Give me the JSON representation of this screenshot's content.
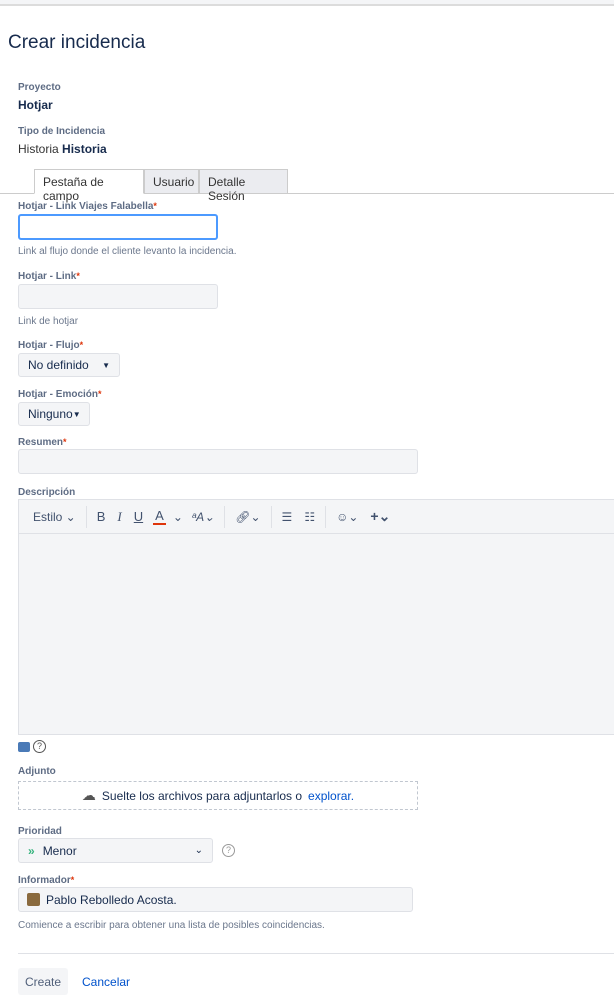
{
  "title": "Crear incidencia",
  "project": {
    "label": "Proyecto",
    "value": "Hotjar"
  },
  "issue_type": {
    "label": "Tipo de Incidencia",
    "icon_alt": "Historia",
    "value": "Historia"
  },
  "tabs": [
    {
      "label": "Pestaña de campo",
      "active": true
    },
    {
      "label": "Usuario"
    },
    {
      "label": "Detalle Sesión"
    }
  ],
  "fields": {
    "link_viajes": {
      "label": "Hotjar - Link Viajes Falabella",
      "required": "*",
      "value": "",
      "hint": "Link al flujo donde el cliente levanto la incidencia."
    },
    "link": {
      "label": "Hotjar - Link",
      "required": "*",
      "value": "",
      "hint": "Link de hotjar"
    },
    "flujo": {
      "label": "Hotjar - Flujo",
      "required": "*",
      "value": "No definido"
    },
    "emocion": {
      "label": "Hotjar - Emoción",
      "required": "*",
      "value": "Ninguno"
    },
    "resumen": {
      "label": "Resumen",
      "required": "*",
      "value": ""
    },
    "descripcion": {
      "label": "Descripción",
      "toolbar": {
        "style": "Estilo",
        "bold": "B",
        "italic": "I",
        "underline": "U",
        "color": "A",
        "size": "ᵃA"
      }
    },
    "adjunto": {
      "label": "Adjunto",
      "drop_text": "Suelte los archivos para adjuntarlos o",
      "browse": "explorar."
    },
    "prioridad": {
      "label": "Prioridad",
      "value": "Menor",
      "color": "#36b37e"
    },
    "informador": {
      "label": "Informador",
      "required": "*",
      "value": "Pablo Rebolledo Acosta.",
      "hint": "Comience a escribir para obtener una lista de posibles coincidencias."
    }
  },
  "actions": {
    "create": "Create",
    "cancel": "Cancelar"
  }
}
